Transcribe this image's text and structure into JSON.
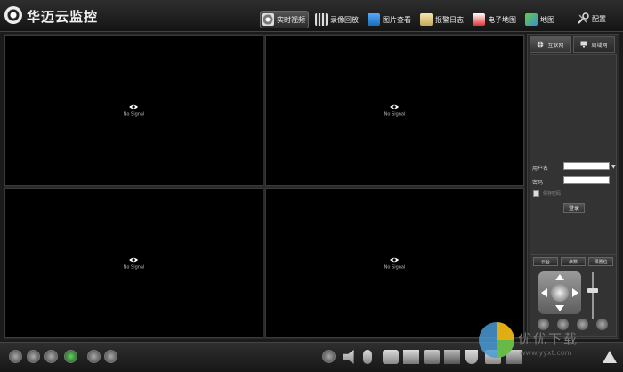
{
  "app": {
    "title": "华迈云监控"
  },
  "nav": [
    {
      "label": "实时视频",
      "icon": "camera-icon",
      "active": true
    },
    {
      "label": "录像回放",
      "icon": "film-icon",
      "active": false
    },
    {
      "label": "图片查看",
      "icon": "picture-icon",
      "active": false
    },
    {
      "label": "报警日志",
      "icon": "log-icon",
      "active": false
    },
    {
      "label": "电子地图",
      "icon": "map-pin-icon",
      "active": false
    },
    {
      "label": "地图",
      "icon": "map-icon",
      "active": false
    }
  ],
  "config": {
    "label": "配置",
    "icon": "tools-icon"
  },
  "tiles": [
    {
      "label": "No Signal"
    },
    {
      "label": "No Signal"
    },
    {
      "label": "No Signal"
    },
    {
      "label": "No Signal"
    }
  ],
  "panel": {
    "tabs": [
      {
        "label": "互联网",
        "icon": "globe-icon"
      },
      {
        "label": "局域网",
        "icon": "monitor-icon"
      }
    ],
    "username_label": "用户名",
    "password_label": "密码",
    "username_value": "",
    "password_value": "",
    "remember_label": "保存密码",
    "login_label": "登录"
  },
  "ptz": {
    "tabs": [
      "云台",
      "参数",
      "预置位"
    ]
  },
  "watermark": {
    "text": "优优下载",
    "url": "www.yyxt.com"
  },
  "colors": {
    "background": "#1b1b1b",
    "tile": "#000000",
    "accent_green": "#3c8f3c"
  }
}
